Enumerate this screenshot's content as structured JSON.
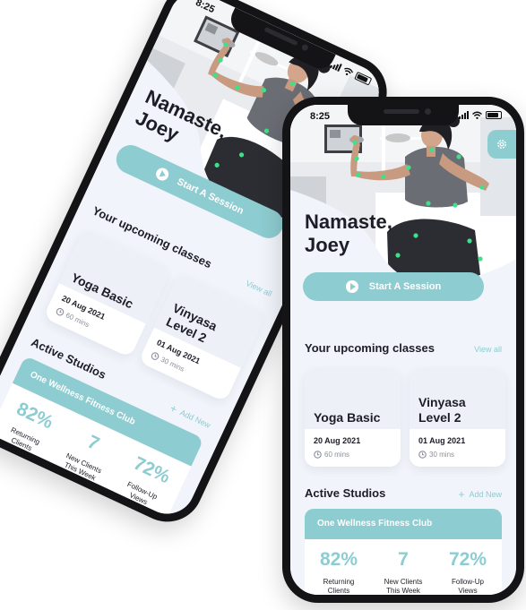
{
  "status_bar": {
    "time": "8:25"
  },
  "hero": {
    "greeting": "Namaste,\nJoey",
    "start_label": "Start A Session"
  },
  "upcoming": {
    "title": "Your upcoming classes",
    "view_all": "View all",
    "classes": [
      {
        "name": "Yoga Basic",
        "date": "20 Aug 2021",
        "duration": "60 mins"
      },
      {
        "name": "Vinyasa\nLevel 2",
        "date": "01 Aug 2021",
        "duration": "30 mins"
      }
    ]
  },
  "studios": {
    "title": "Active Studios",
    "add_new": "Add New",
    "studio_name": "One Wellness Fitness Club",
    "stats": [
      {
        "value": "82%",
        "label": "Returning\nClients"
      },
      {
        "value": "7",
        "label": "New Clients\nThis Week"
      },
      {
        "value": "72%",
        "label": "Follow-Up\nViews"
      }
    ]
  },
  "colors": {
    "accent": "#8dccd0",
    "background": "#f1f4fa",
    "text": "#1d1d28",
    "phone_frame": "#141416"
  },
  "icons": [
    "settings-gear-icon",
    "play-icon",
    "clock-icon",
    "plus-icon",
    "signal-icon",
    "wifi-icon",
    "battery-icon"
  ]
}
